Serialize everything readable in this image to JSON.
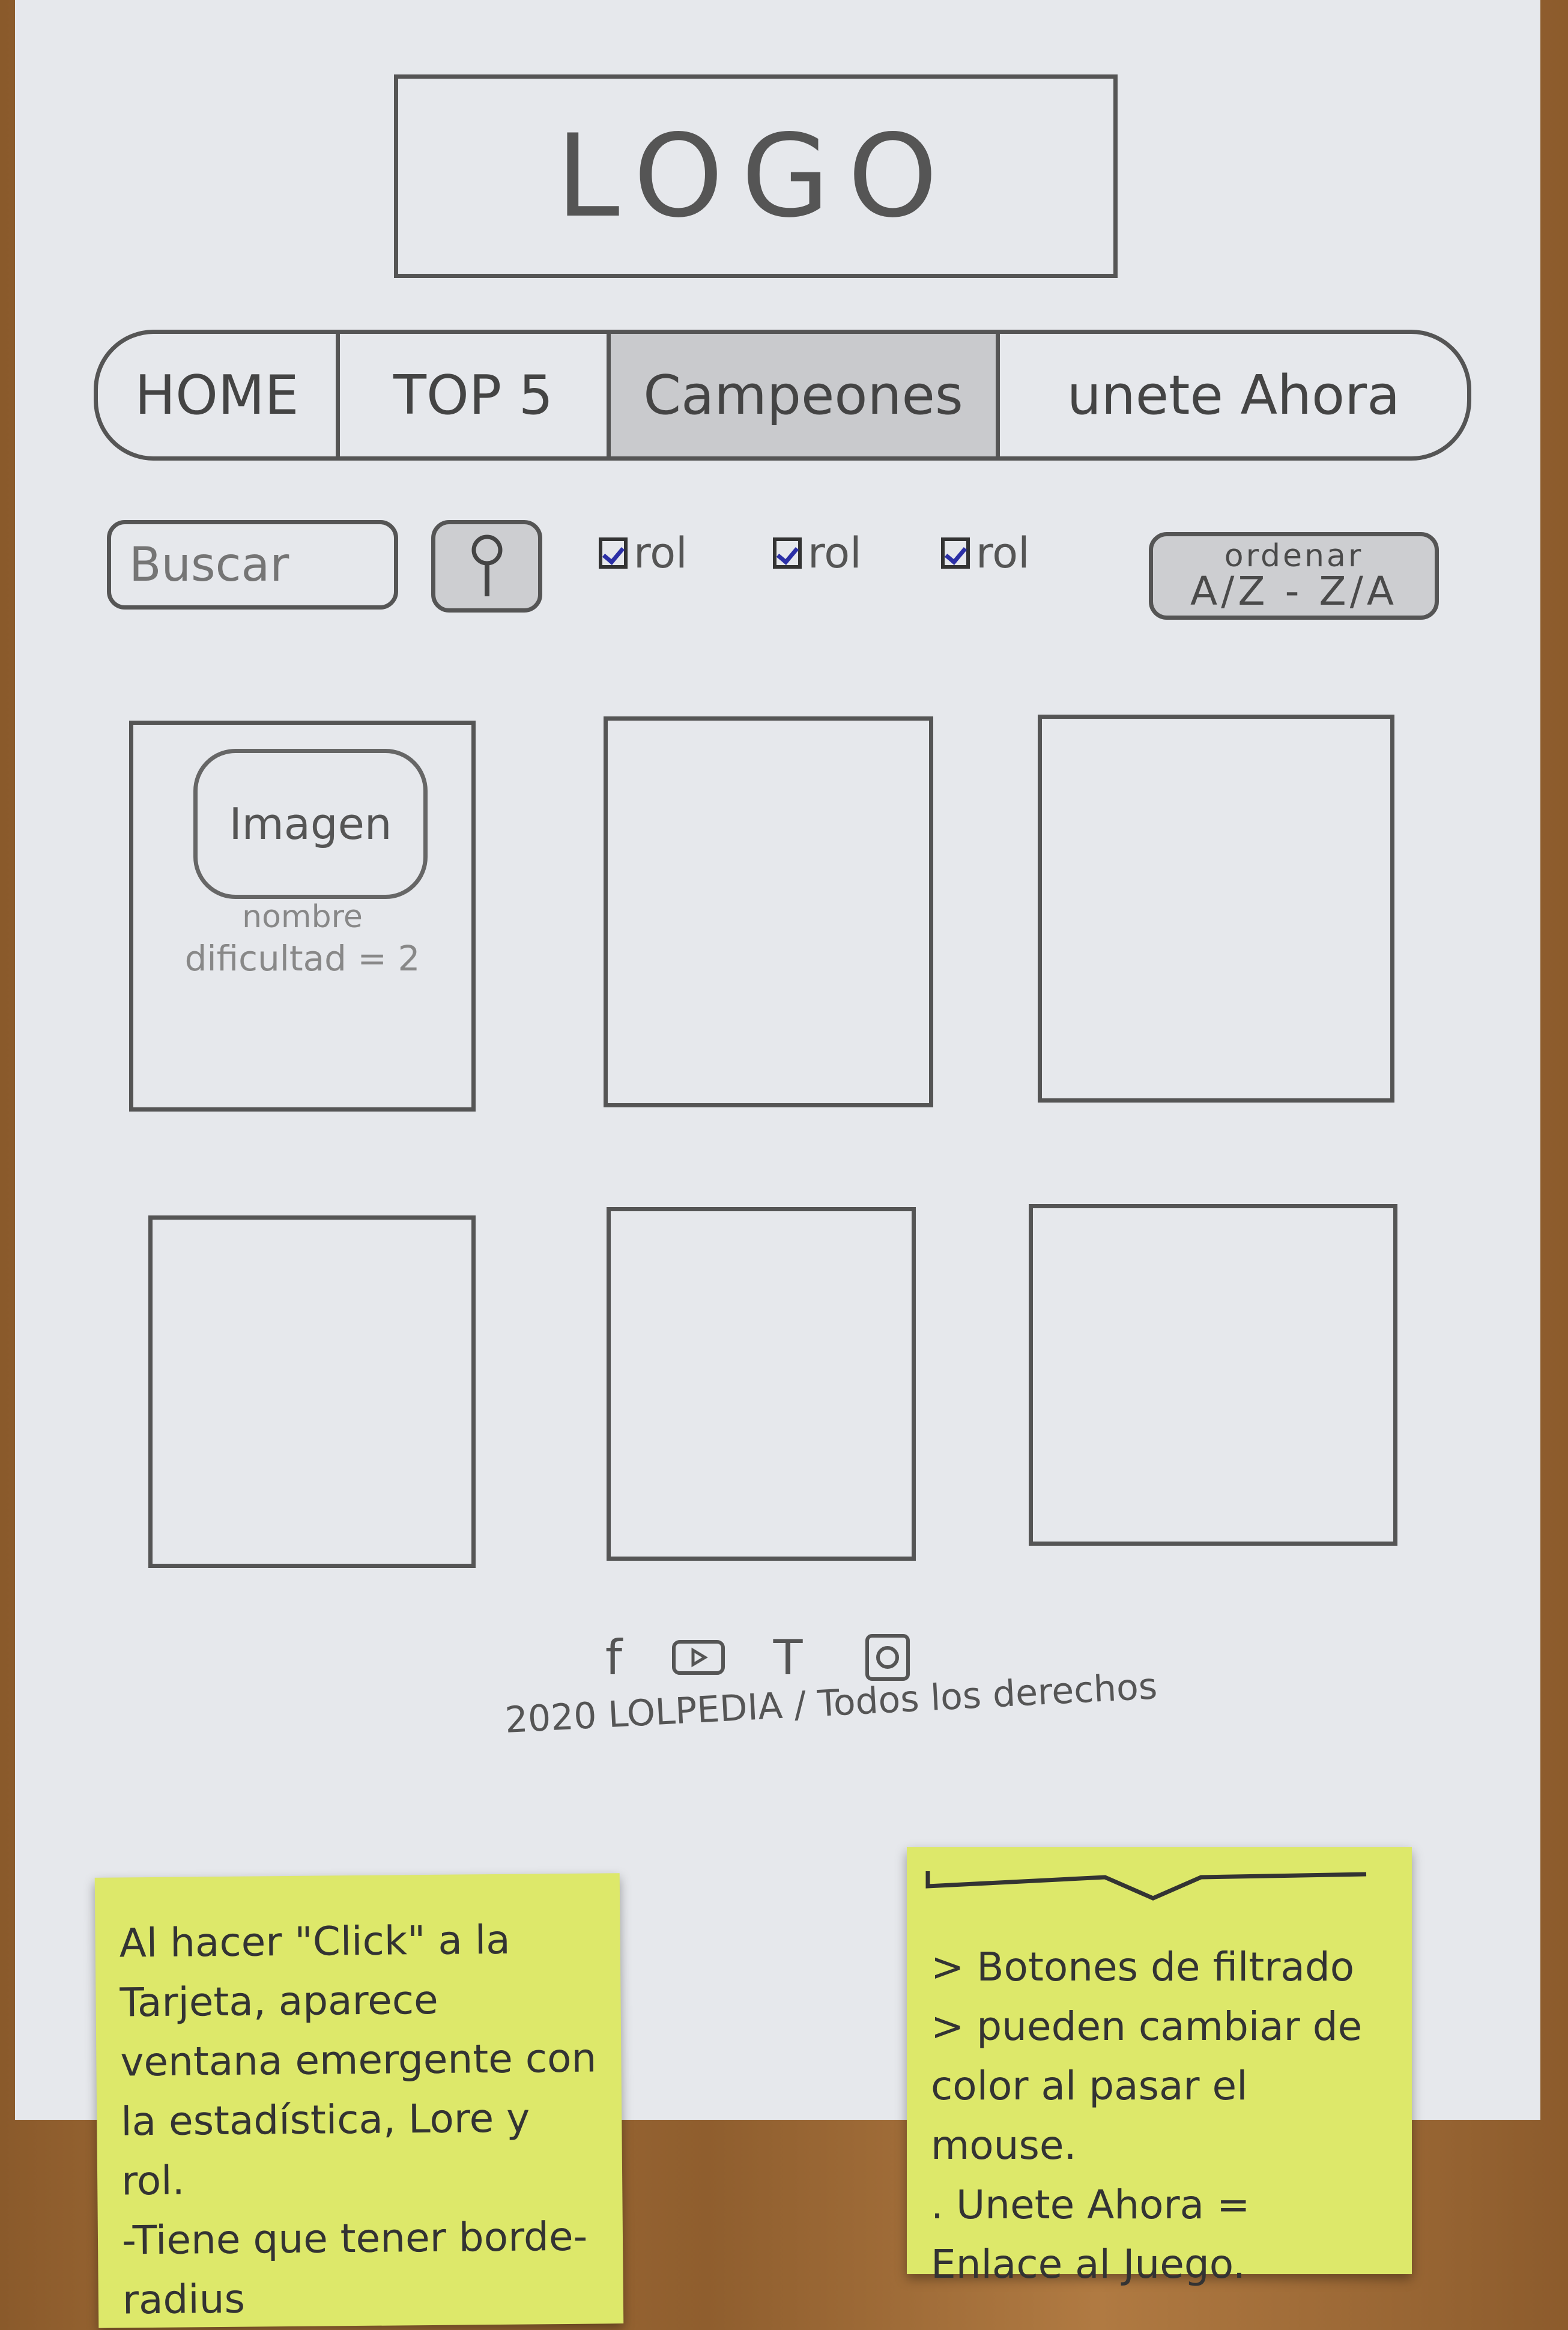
{
  "logo": {
    "text": "LOGO"
  },
  "nav": {
    "items": [
      {
        "label": "HOME",
        "active": false
      },
      {
        "label": "TOP 5",
        "active": false
      },
      {
        "label": "Campeones",
        "active": true
      },
      {
        "label": "unete Ahora",
        "active": false
      }
    ]
  },
  "toolbar": {
    "search_placeholder": "Buscar",
    "search_icon": "magnifier-icon",
    "filters": [
      {
        "label": "rol",
        "checked": true
      },
      {
        "label": "rol",
        "checked": true
      },
      {
        "label": "rol",
        "checked": true
      }
    ],
    "order": {
      "label": "ordenar",
      "value": "A/Z - Z/A"
    }
  },
  "cards": [
    {
      "image_label": "Imagen",
      "name": "nombre",
      "difficulty": "dificultad = 2"
    },
    {},
    {},
    {},
    {},
    {}
  ],
  "footer": {
    "icons": [
      "facebook-icon",
      "youtube-icon",
      "twitter-icon",
      "instagram-icon"
    ],
    "copyright": "2020 LOLPEDIA / Todos los derechos"
  },
  "notes": {
    "left": [
      "Al hacer \"Click\" a la Tarjeta, aparece ventana emergente con la estadística, Lore y rol.",
      "-Tiene que tener borde-radius"
    ],
    "right": [
      "> Botones de filtrado",
      "> pueden cambiar de color al pasar el mouse.",
      ". Unete Ahora = Enlace al Juego."
    ]
  },
  "colors": {
    "paper": "#e6e8ec",
    "pencil": "#555555",
    "sticky": "#dde86a",
    "checkmark": "#2b2fa6",
    "wood": "#9a6633"
  }
}
